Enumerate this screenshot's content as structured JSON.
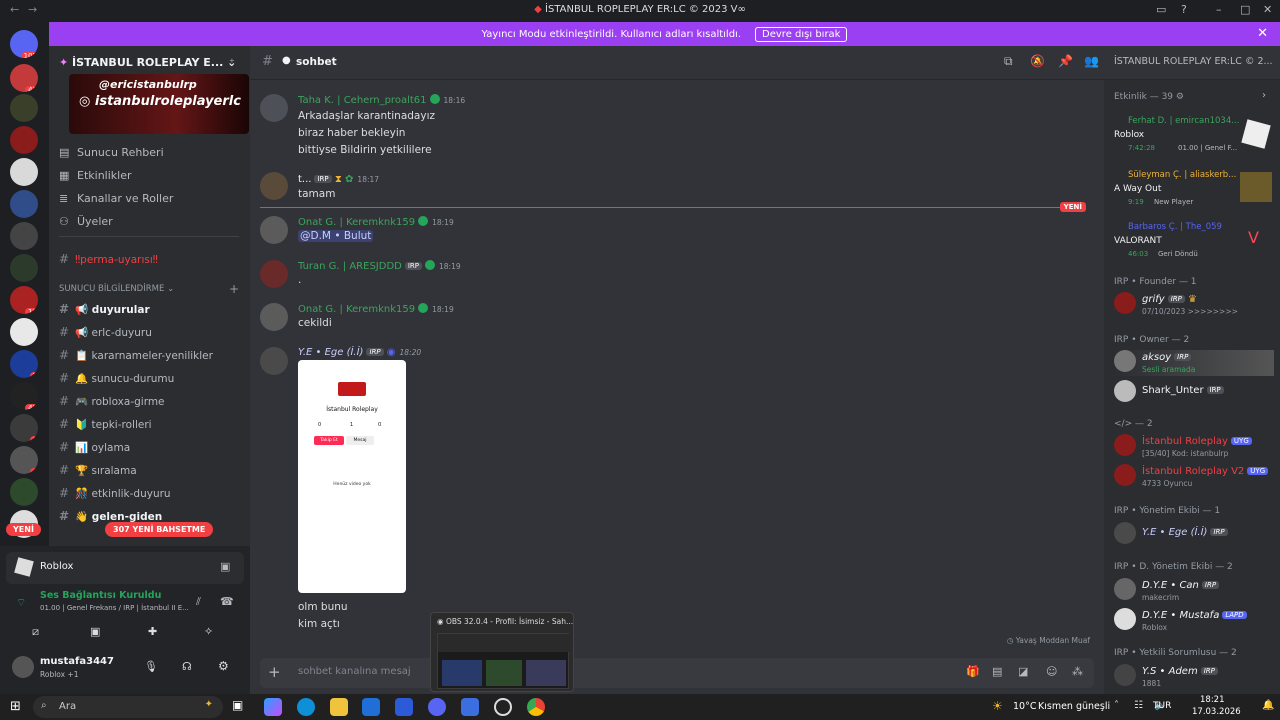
{
  "window": {
    "title": "İSTANBUL ROPLEPLAY ER:LC © 2023 V∞",
    "title_icon": "playstation-logo-icon"
  },
  "banner": {
    "text": "Yayıncı Modu etkinleştirildi. Kullanıcı adları kısaltıldı.",
    "button": "Devre dışı bırak",
    "color": "#9b3ff2"
  },
  "rail": {
    "badges": [
      "105",
      "48",
      "10",
      "2",
      "49",
      "6",
      "4"
    ],
    "yeni": "YENİ"
  },
  "server": {
    "name": "İSTANBUL ROLEPLAY E...",
    "banner_line1": "@ericistanbulrp",
    "banner_line2": "istanbulroleplayerlc",
    "nav": [
      "Sunucu Rehberi",
      "Etkinlikler",
      "Kanallar ve Roller",
      "Üyeler"
    ],
    "pinned_channel": "‼perma-uyarısı‼",
    "category": "SUNUCU BİLGİLENDİRME",
    "channels": [
      {
        "name": "duyurular",
        "bold": true,
        "emoji": "📢"
      },
      {
        "name": "erlc-duyuru",
        "bold": false,
        "emoji": "📢"
      },
      {
        "name": "kararnameler-yenilikler",
        "bold": false,
        "emoji": "📋"
      },
      {
        "name": "sunucu-durumu",
        "bold": false,
        "emoji": "🔔"
      },
      {
        "name": "robloxa-girme",
        "bold": false,
        "emoji": "🎮"
      },
      {
        "name": "tepki-rolleri",
        "bold": false,
        "emoji": "🔰"
      },
      {
        "name": "oylama",
        "bold": false,
        "emoji": "📊"
      },
      {
        "name": "sıralama",
        "bold": false,
        "emoji": "🏆"
      },
      {
        "name": "etkinlik-duyuru",
        "bold": false,
        "emoji": "🎊"
      },
      {
        "name": "gelen-giden",
        "bold": true,
        "emoji": "👋"
      }
    ],
    "new_messages_pill": "307 YENİ BAHSETME"
  },
  "voice": {
    "activity": "Roblox",
    "status": "Ses Bağlantısı Kuruldu",
    "detail": "01.00 | Genel Frekans / IRP | İstanbul II E..."
  },
  "user": {
    "name": "mustafa3447",
    "status": "Roblox +1"
  },
  "chat": {
    "channel": "sohbet",
    "messages": [
      {
        "author": "Taha K. | Cehern_proalt61",
        "color": "#3ba55c",
        "time": "18:16",
        "lines": [
          "Arkadaşlar karantinadayız",
          "biraz haber bekleyin",
          "bittiyse Bildirin yetkililere"
        ]
      },
      {
        "author": "t...",
        "color": "#f2f3f5",
        "tag": "IRP",
        "time": "18:17",
        "lines": [
          "tamam"
        ]
      },
      {
        "author": "Onat G. | Keremknk159",
        "color": "#3ba55c",
        "time": "18:19",
        "lines": [
          "@D.M • Bulut"
        ]
      },
      {
        "author": "Turan G. | ARESJDDD",
        "color": "#3ba55c",
        "tag": "IRP",
        "time": "18:19",
        "lines": [
          "."
        ]
      },
      {
        "author": "Onat G. | Keremknk159",
        "color": "#3ba55c",
        "time": "18:19",
        "lines": [
          "cekildi"
        ]
      },
      {
        "author": "Y.E • Ege (İ.İ)",
        "color": "#c9cdfb",
        "tag": "IRP",
        "time": "18:20",
        "lines": [
          "olm bunu",
          "kim açtı"
        ]
      }
    ],
    "new_marker": "YENİ",
    "phone": {
      "title": "İstanbul Roleplay",
      "stats": [
        "0",
        "1",
        "0"
      ],
      "follow": "Takip Et",
      "message": "Mesaj",
      "empty": "Henüz video yok"
    },
    "slowmode": "Yavaş Moddan Muaf",
    "placeholder": "sohbet kanalına mesaj"
  },
  "members": {
    "server_label": "İSTANBUL ROLEPLAY ER:LC © 2...",
    "activity_header": "Etkinlik — 39",
    "activities": [
      {
        "user": "Ferhat D. | emircan1034...",
        "game": "Roblox",
        "meta1": "7:42:28",
        "meta2": "01.00 | Genel F..."
      },
      {
        "user": "Süleyman Ç. | aliaskerb...",
        "game": "A Way Out",
        "meta1": "9:19",
        "meta2": "New Player"
      },
      {
        "user": "Barbaros Ç. | The_059",
        "game": "VALORANT",
        "meta1": "46:03",
        "meta2": "Geri Döndü"
      }
    ],
    "groups": [
      {
        "header": "IRP • Founder — 1",
        "members": [
          {
            "name": "grify",
            "tag": "IRP",
            "sub": "07/10/2023 >>>>>>>>",
            "color": "#f2f3f5"
          }
        ]
      },
      {
        "header": "IRP • Owner — 2",
        "members": [
          {
            "name": "aksoy",
            "tag": "IRP",
            "sub": "Sesli aramada",
            "color": "#f2f3f5"
          },
          {
            "name": "Shark_Unter",
            "tag": "IRP",
            "sub": "",
            "color": "#f2f3f5"
          }
        ]
      },
      {
        "header": "</> — 2",
        "members": [
          {
            "name": "İstanbul Roleplay",
            "tag": "UYG",
            "sub": "[35/40] Kod: istanbulrp",
            "color": "#f23f42"
          },
          {
            "name": "İstanbul Roleplay V2",
            "tag": "UYG",
            "sub": "4733 Oyuncu",
            "color": "#f23f42"
          }
        ]
      },
      {
        "header": "IRP • Yönetim Ekibi — 1",
        "members": [
          {
            "name": "Y.E • Ege (İ.İ)",
            "tag": "IRP",
            "sub": "",
            "color": "#c9cdfb"
          }
        ]
      },
      {
        "header": "IRP • D. Yönetim Ekibi — 2",
        "members": [
          {
            "name": "D.Y.E • Can",
            "tag": "IRP",
            "sub": "makecrim",
            "color": "#f2f3f5"
          },
          {
            "name": "D.Y.E • Mustafa",
            "tag": "LAPD",
            "sub": "Roblox",
            "color": "#f2f3f5"
          }
        ]
      },
      {
        "header": "IRP • Yetkili Sorumlusu — 2",
        "members": [
          {
            "name": "Y.S • Adem",
            "tag": "IRP",
            "sub": "1881",
            "color": "#f2f3f5"
          }
        ]
      }
    ]
  },
  "taskbar": {
    "search": "Ara",
    "weather_temp": "10°C",
    "weather_text": "Kısmen güneşli",
    "lang": "TUR",
    "time": "18:21",
    "date": "17.03.2026",
    "obs_title": "OBS 32.0.4 - Profil: İsimsiz - Sah..."
  }
}
